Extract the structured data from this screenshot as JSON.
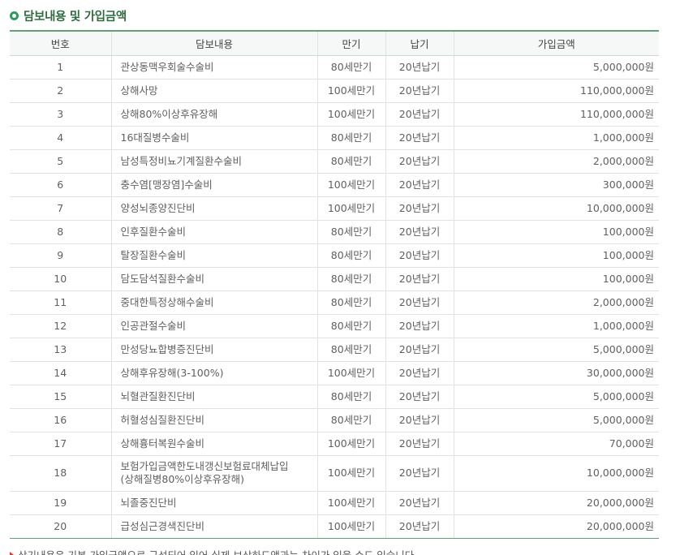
{
  "section": {
    "title": "담보내용 및 가입금액",
    "icon": "circle-bullet-icon",
    "accent_color": "#2e9a62"
  },
  "table": {
    "headers": {
      "no": "번호",
      "coverage": "담보내용",
      "maturity": "만기",
      "payment": "납기",
      "amount": "가입금액"
    },
    "rows": [
      {
        "no": "1",
        "coverage": "관상동맥우회술수술비",
        "maturity": "80세만기",
        "payment": "20년납기",
        "amount": "5,000,000원"
      },
      {
        "no": "2",
        "coverage": "상해사망",
        "maturity": "100세만기",
        "payment": "20년납기",
        "amount": "110,000,000원"
      },
      {
        "no": "3",
        "coverage": "상해80%이상후유장해",
        "maturity": "100세만기",
        "payment": "20년납기",
        "amount": "110,000,000원"
      },
      {
        "no": "4",
        "coverage": "16대질병수술비",
        "maturity": "80세만기",
        "payment": "20년납기",
        "amount": "1,000,000원"
      },
      {
        "no": "5",
        "coverage": "남성특정비뇨기계질환수술비",
        "maturity": "80세만기",
        "payment": "20년납기",
        "amount": "2,000,000원"
      },
      {
        "no": "6",
        "coverage": "충수염[맹장염]수술비",
        "maturity": "100세만기",
        "payment": "20년납기",
        "amount": "300,000원"
      },
      {
        "no": "7",
        "coverage": "양성뇌종양진단비",
        "maturity": "100세만기",
        "payment": "20년납기",
        "amount": "10,000,000원"
      },
      {
        "no": "8",
        "coverage": "인후질환수술비",
        "maturity": "80세만기",
        "payment": "20년납기",
        "amount": "100,000원"
      },
      {
        "no": "9",
        "coverage": "탈장질환수술비",
        "maturity": "80세만기",
        "payment": "20년납기",
        "amount": "100,000원"
      },
      {
        "no": "10",
        "coverage": "담도담석질환수술비",
        "maturity": "80세만기",
        "payment": "20년납기",
        "amount": "100,000원"
      },
      {
        "no": "11",
        "coverage": "중대한특정상해수술비",
        "maturity": "80세만기",
        "payment": "20년납기",
        "amount": "2,000,000원"
      },
      {
        "no": "12",
        "coverage": "인공관절수술비",
        "maturity": "80세만기",
        "payment": "20년납기",
        "amount": "1,000,000원"
      },
      {
        "no": "13",
        "coverage": "만성당뇨합병증진단비",
        "maturity": "80세만기",
        "payment": "20년납기",
        "amount": "5,000,000원"
      },
      {
        "no": "14",
        "coverage": "상해후유장해(3-100%)",
        "maturity": "100세만기",
        "payment": "20년납기",
        "amount": "30,000,000원"
      },
      {
        "no": "15",
        "coverage": "뇌혈관질환진단비",
        "maturity": "80세만기",
        "payment": "20년납기",
        "amount": "5,000,000원"
      },
      {
        "no": "16",
        "coverage": "허혈성심질환진단비",
        "maturity": "80세만기",
        "payment": "20년납기",
        "amount": "5,000,000원"
      },
      {
        "no": "17",
        "coverage": "상해흉터복원수술비",
        "maturity": "100세만기",
        "payment": "20년납기",
        "amount": "70,000원"
      },
      {
        "no": "18",
        "coverage": "보험가입금액한도내갱신보험료대체납입",
        "coverage_sub": "(상해질병80%이상후유장해)",
        "maturity": "100세만기",
        "payment": "20년납기",
        "amount": "10,000,000원"
      },
      {
        "no": "19",
        "coverage": "뇌졸중진단비",
        "maturity": "100세만기",
        "payment": "20년납기",
        "amount": "20,000,000원"
      },
      {
        "no": "20",
        "coverage": "급성심근경색진단비",
        "maturity": "100세만기",
        "payment": "20년납기",
        "amount": "20,000,000원"
      }
    ]
  },
  "note": {
    "text": "상기내용은 기본 가입금액으로 구성되어 있어 실제 보상하도액과는 차이가 있을 수도 있습니다.",
    "icon": "red-arrow-bullet-icon"
  }
}
